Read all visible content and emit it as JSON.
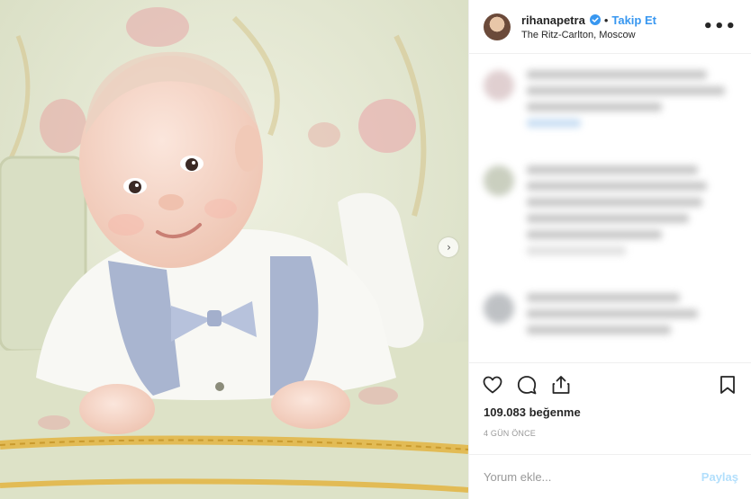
{
  "post": {
    "username": "rihanapetra",
    "separator": "•",
    "follow_label": "Takip Et",
    "location": "The Ritz-Carlton, Moscow",
    "more_label": "•••",
    "likes": "109.083 beğenme",
    "time_ago": "4 GÜN ÖNCE",
    "comment_placeholder": "Yorum ekle...",
    "share_label": "Paylaş"
  },
  "icons": {
    "verified": "verified-badge-icon",
    "like": "heart-icon",
    "comment": "speech-bubble-icon",
    "share": "share-icon",
    "save": "bookmark-icon",
    "next": "chevron-right-icon"
  },
  "colors": {
    "follow": "#3897f0",
    "verified": "#3897f0",
    "share_disabled": "#b2dffc",
    "muted": "#999999"
  }
}
